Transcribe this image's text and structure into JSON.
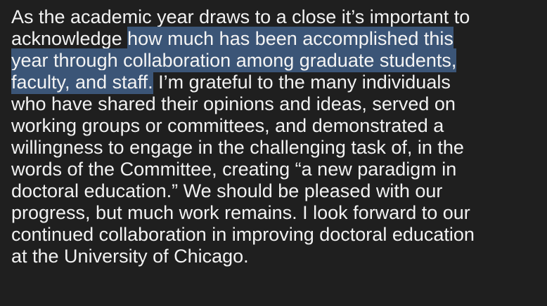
{
  "document": {
    "lines": [
      {
        "before": "As the academic year draws to a close it’s important to",
        "highlight": "",
        "after": ""
      },
      {
        "before": "acknowledge ",
        "highlight": "how much has been accomplished this",
        "after": ""
      },
      {
        "before": "",
        "highlight": "year through collaboration among graduate students,",
        "after": ""
      },
      {
        "before": "",
        "highlight": "faculty, and staff.",
        "after": " I’m grateful to the many individuals"
      },
      {
        "before": "who have shared their opinions and ideas, served on",
        "highlight": "",
        "after": ""
      },
      {
        "before": "working groups or committees, and demonstrated a",
        "highlight": "",
        "after": ""
      },
      {
        "before": "willingness to engage in the challenging task of, in the",
        "highlight": "",
        "after": ""
      },
      {
        "before": "words of the Committee, creating “a new paradigm in",
        "highlight": "",
        "after": ""
      },
      {
        "before": "doctoral education.” We should be pleased with our",
        "highlight": "",
        "after": ""
      },
      {
        "before": "progress, but much work remains. I look forward to our",
        "highlight": "",
        "after": ""
      },
      {
        "before": "continued collaboration in improving doctoral education",
        "highlight": "",
        "after": ""
      },
      {
        "before": "at the University of Chicago.",
        "highlight": "",
        "after": ""
      }
    ]
  },
  "colors": {
    "background": "#1f1f1f",
    "text": "#f2f2f2",
    "selection": "#3b5577"
  }
}
